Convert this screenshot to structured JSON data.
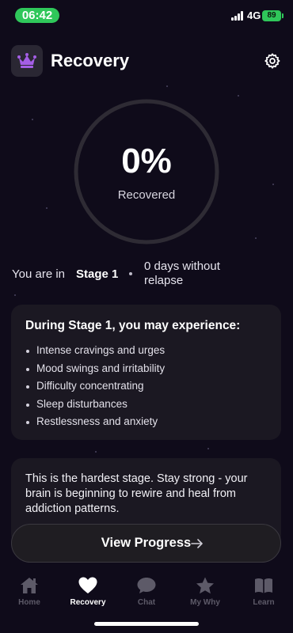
{
  "status_bar": {
    "time": "06:42",
    "network": "4G",
    "battery": "89"
  },
  "header": {
    "title": "Recovery",
    "app_icon": "crown-icon",
    "settings_icon": "gear-icon"
  },
  "progress": {
    "percent_label": "0%",
    "percent_value": 0,
    "caption": "Recovered"
  },
  "stage": {
    "prefix": "You are in",
    "name": "Stage 1",
    "days": "0 days without relapse"
  },
  "symptoms_card": {
    "title": "During Stage 1, you may experience:",
    "items": [
      "Intense cravings and urges",
      "Mood swings and irritability",
      "Difficulty concentrating",
      "Sleep disturbances",
      "Restlessness and anxiety"
    ]
  },
  "info_card": {
    "text": "This is the hardest stage. Stay strong - your brain is beginning to rewire and heal from addiction patterns."
  },
  "view_progress": {
    "label": "View Progress"
  },
  "tabs": [
    {
      "label": "Home",
      "icon": "home-icon"
    },
    {
      "label": "Recovery",
      "icon": "heart-icon"
    },
    {
      "label": "Chat",
      "icon": "chat-bubble-icon"
    },
    {
      "label": "My Why",
      "icon": "star-icon"
    },
    {
      "label": "Learn",
      "icon": "book-icon"
    }
  ],
  "colors": {
    "background": "#0f0b1a",
    "card": "#1b1822",
    "accent_purple": "#a45ee5",
    "status_green": "#2fc75a",
    "inactive_tab": "#5d5a68"
  }
}
